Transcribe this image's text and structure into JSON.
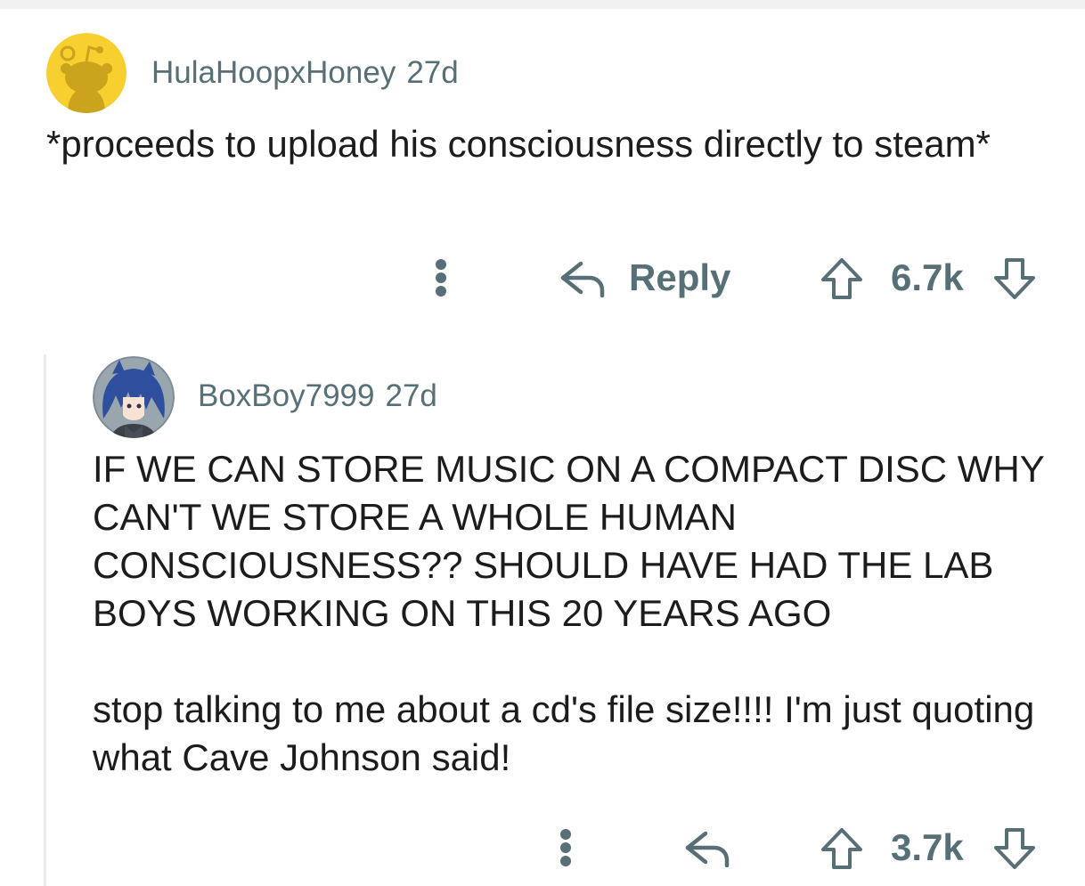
{
  "comments": [
    {
      "username": "HulaHoopxHoney",
      "age": "27d",
      "avatar": "snoo-avatar-yellow",
      "body": "*proceeds to upload his consciousness directly to steam*",
      "actions": {
        "more_icon": "vertical-dots-icon",
        "reply_icon": "reply-arrow-icon",
        "reply_label": "Reply",
        "upvote_icon": "upvote-arrow-icon",
        "score": "6.7k",
        "downvote_icon": "downvote-arrow-icon"
      }
    },
    {
      "username": "BoxBoy7999",
      "age": "27d",
      "avatar": "anime-character-avatar",
      "body_paragraphs": [
        "IF WE CAN STORE MUSIC ON A COMPACT DISC WHY CAN'T WE STORE A WHOLE HUMAN CONSCIOUSNESS?? SHOULD HAVE HAD THE LAB BOYS WORKING ON THIS 20 YEARS AGO",
        "stop talking to me about a cd's file size!!!! I'm just quoting what Cave Johnson said!"
      ],
      "actions": {
        "more_icon": "vertical-dots-icon",
        "reply_icon": "reply-arrow-icon",
        "upvote_icon": "upvote-arrow-icon",
        "score": "3.7k",
        "downvote_icon": "downvote-arrow-icon"
      }
    }
  ],
  "colors": {
    "text": "#1c1c1c",
    "meta": "#576f76",
    "thread_line": "#e5ebee",
    "snoo_yellow": "#f7cf2f"
  }
}
